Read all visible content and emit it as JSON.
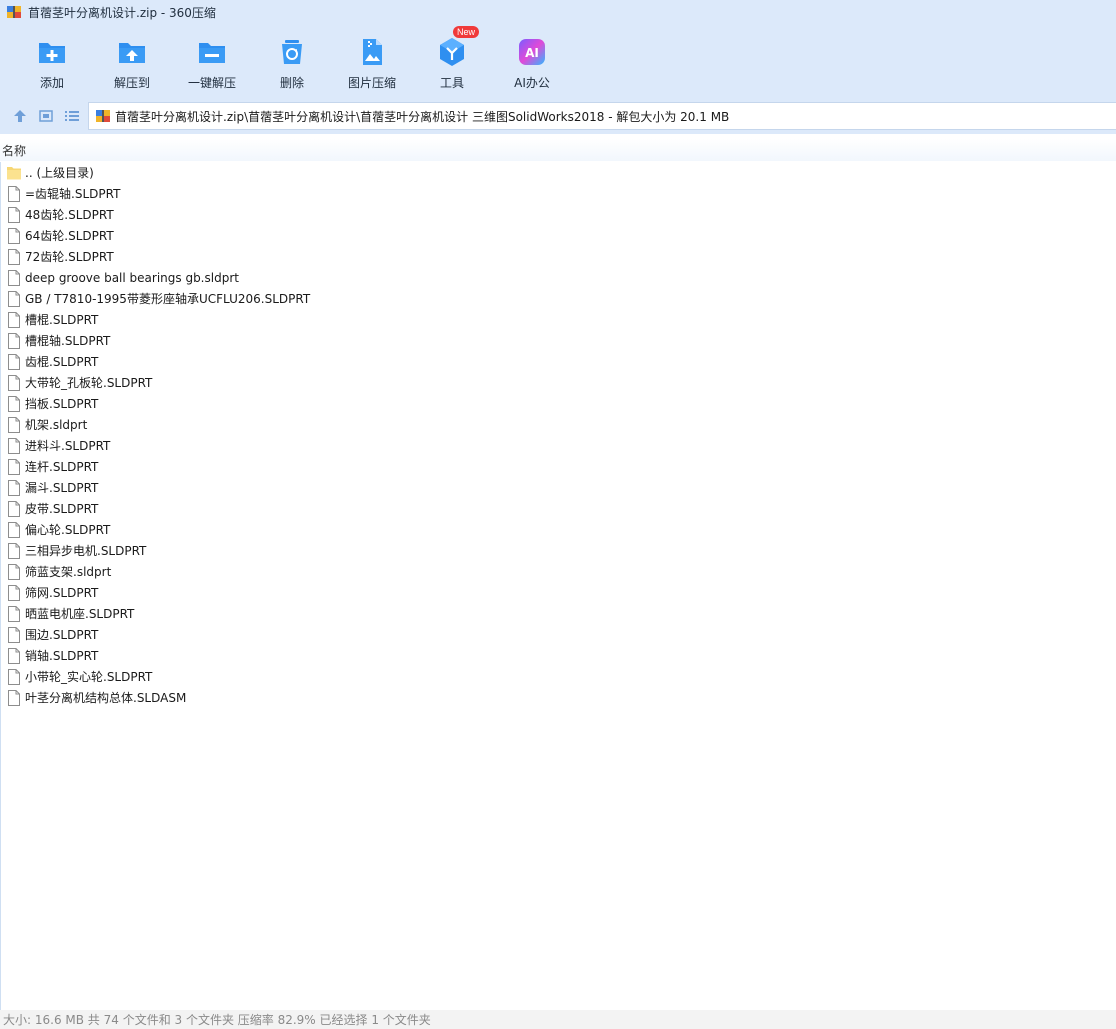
{
  "window": {
    "title": "苜蓿茎叶分离机设计.zip - 360压缩"
  },
  "toolbar": {
    "buttons": [
      {
        "label": "添加",
        "icon": "add-icon"
      },
      {
        "label": "解压到",
        "icon": "extract-to-icon"
      },
      {
        "label": "一键解压",
        "icon": "one-click-extract-icon"
      },
      {
        "label": "删除",
        "icon": "delete-icon"
      },
      {
        "label": "图片压缩",
        "icon": "image-compress-icon"
      },
      {
        "label": "工具",
        "icon": "tools-icon",
        "badge": "New"
      },
      {
        "label": "AI办公",
        "icon": "ai-office-icon"
      }
    ],
    "accent": "#2f8ff0"
  },
  "address": {
    "path": "苜蓿茎叶分离机设计.zip\\苜蓿茎叶分离机设计\\苜蓿茎叶分离机设计 三维图SolidWorks2018 - 解包大小为 20.1 MB"
  },
  "list": {
    "column_name": "名称",
    "parent_label": ".. (上级目录)",
    "files": [
      "=齿辊轴.SLDPRT",
      "48齿轮.SLDPRT",
      "64齿轮.SLDPRT",
      "72齿轮.SLDPRT",
      "deep groove ball bearings gb.sldprt",
      "GB / T7810-1995带菱形座轴承UCFLU206.SLDPRT",
      "槽棍.SLDPRT",
      "槽棍轴.SLDPRT",
      "齿棍.SLDPRT",
      "大带轮_孔板轮.SLDPRT",
      "挡板.SLDPRT",
      "机架.sldprt",
      "进料斗.SLDPRT",
      "连杆.SLDPRT",
      "漏斗.SLDPRT",
      "皮带.SLDPRT",
      "偏心轮.SLDPRT",
      "三相异步电机.SLDPRT",
      "筛蓝支架.sldprt",
      "筛网.SLDPRT",
      "晒蓝电机座.SLDPRT",
      "围边.SLDPRT",
      "销轴.SLDPRT",
      "小带轮_实心轮.SLDPRT",
      "叶茎分离机结构总体.SLDASM"
    ]
  },
  "status": {
    "text": "大小: 16.6 MB 共 74 个文件和 3 个文件夹 压缩率 82.9% 已经选择 1 个文件夹"
  }
}
